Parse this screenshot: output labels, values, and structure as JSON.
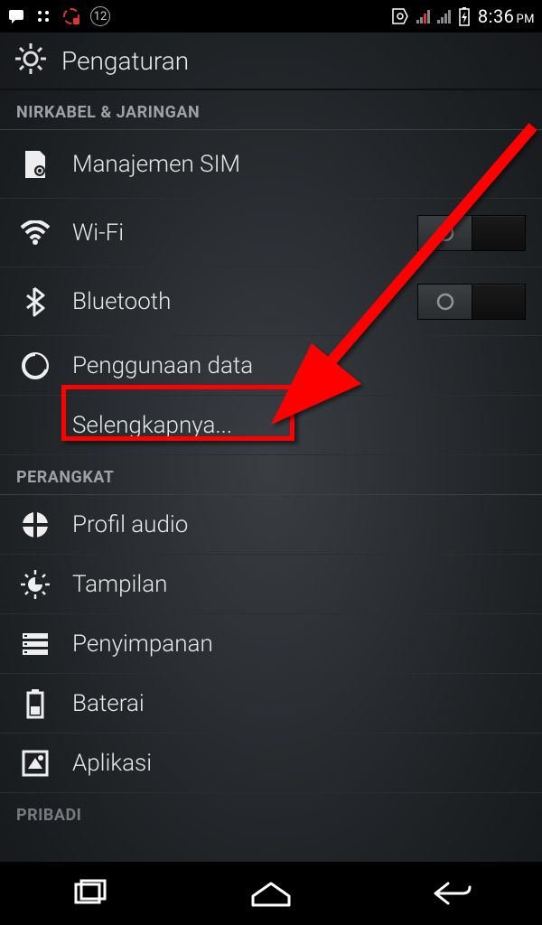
{
  "status": {
    "notif_count": "12",
    "time": "8:36",
    "ampm": "PM"
  },
  "header": {
    "title": "Pengaturan"
  },
  "sections": {
    "wireless": {
      "title": "NIRKABEL & JARINGAN",
      "items": {
        "sim": "Manajemen SIM",
        "wifi": "Wi-Fi",
        "bluetooth": "Bluetooth",
        "data": "Penggunaan data",
        "more": "Selengkapnya..."
      }
    },
    "device": {
      "title": "PERANGKAT",
      "items": {
        "audio": "Profil audio",
        "display": "Tampilan",
        "storage": "Penyimpanan",
        "battery": "Baterai",
        "apps": "Aplikasi"
      }
    },
    "personal": {
      "title": "PRIBADI"
    }
  },
  "toggles": {
    "wifi": "off",
    "bluetooth": "off"
  },
  "annotation": {
    "highlight_target": "more",
    "color": "#ff0000"
  }
}
